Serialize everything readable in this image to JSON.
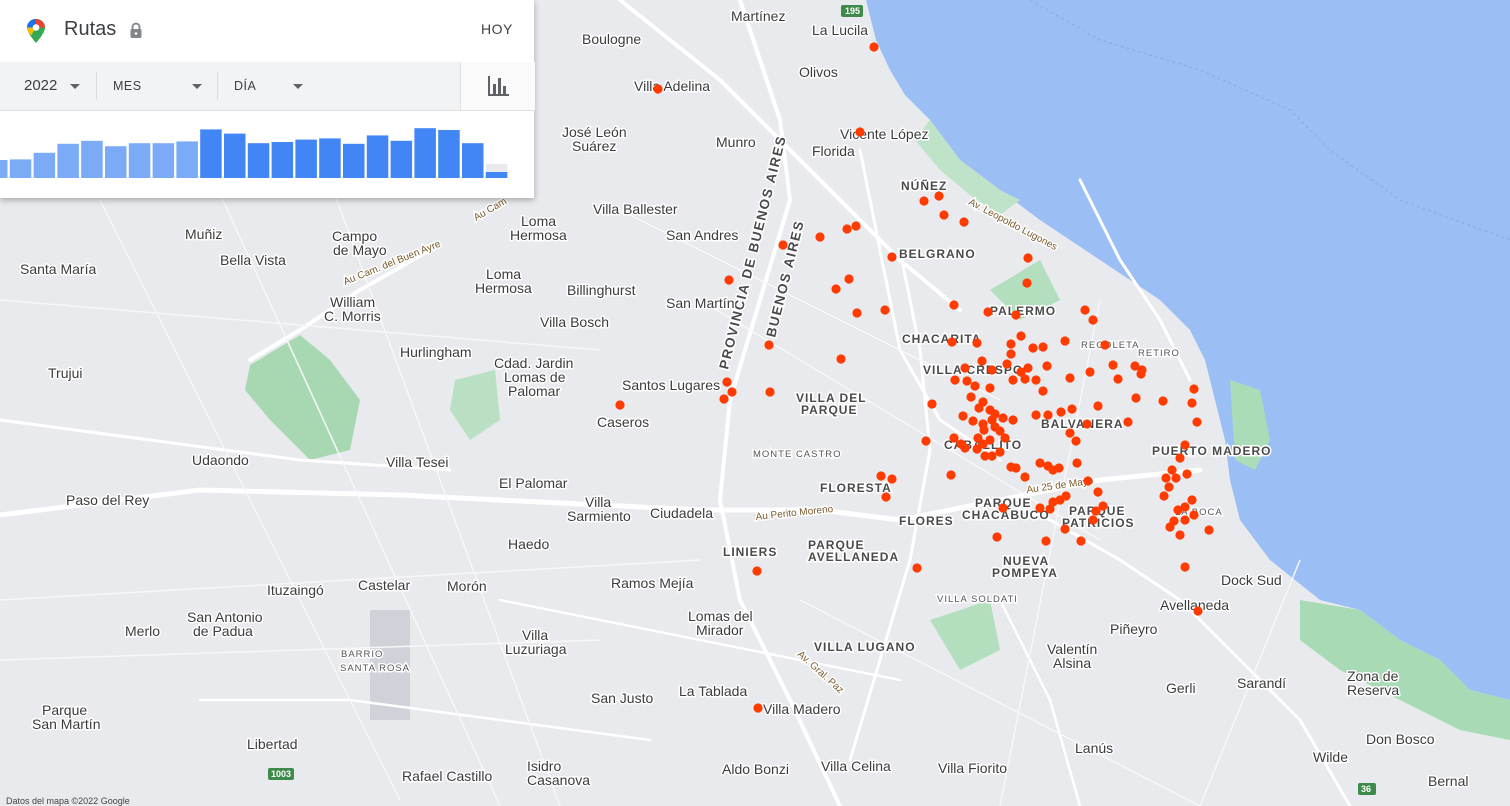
{
  "panel": {
    "title": "Rutas",
    "today_label": "HOY",
    "filters": {
      "year": "2022",
      "month": "MES",
      "day": "DÍA"
    },
    "histogram": {
      "values": [
        0.3,
        0.31,
        0.42,
        0.57,
        0.62,
        0.53,
        0.58,
        0.58,
        0.61,
        0.81,
        0.74,
        0.58,
        0.6,
        0.64,
        0.66,
        0.57,
        0.71,
        0.62,
        0.83,
        0.8,
        0.58,
        0.1
      ],
      "highlight_from_index": 9,
      "light_color": "#7babf6",
      "dark_color": "#4285f4"
    }
  },
  "map": {
    "places": [
      {
        "t": "Martínez"
      },
      {
        "t": "La Lucila"
      },
      {
        "t": "Boulogne"
      },
      {
        "t": "Olivos"
      },
      {
        "t": "Villa Adelina"
      },
      {
        "t": "Vicente López"
      },
      {
        "t": "Florida"
      },
      {
        "t": "José León"
      },
      {
        "t": "Suárez"
      },
      {
        "t": "Munro"
      },
      {
        "t": "Villa Ballester"
      },
      {
        "t": "Muñiz"
      },
      {
        "t": "Campo"
      },
      {
        "t": "de Mayo"
      },
      {
        "t": "Loma"
      },
      {
        "t": "Hermosa"
      },
      {
        "t": "San Andres"
      },
      {
        "t": "Santa María"
      },
      {
        "t": "Bella Vista"
      },
      {
        "t": "Loma"
      },
      {
        "t": "Hermosa"
      },
      {
        "t": "Billinghurst"
      },
      {
        "t": "San Martín"
      },
      {
        "t": "William"
      },
      {
        "t": "C. Morris"
      },
      {
        "t": "Villa Bosch"
      },
      {
        "t": "Hurlingham"
      },
      {
        "t": "Cdad. Jardin"
      },
      {
        "t": "Lomas de"
      },
      {
        "t": "Palomar"
      },
      {
        "t": "Trujui"
      },
      {
        "t": "Santos Lugares"
      },
      {
        "t": "Caseros"
      },
      {
        "t": "Udaondo"
      },
      {
        "t": "Villa Tesei"
      },
      {
        "t": "El Palomar"
      },
      {
        "t": "Paso del Rey"
      },
      {
        "t": "Villa"
      },
      {
        "t": "Sarmiento"
      },
      {
        "t": "Ciudadela"
      },
      {
        "t": "Haedo"
      },
      {
        "t": "Ramos Mejía"
      },
      {
        "t": "Ituzaingó"
      },
      {
        "t": "Castelar"
      },
      {
        "t": "Morón"
      },
      {
        "t": "Merlo"
      },
      {
        "t": "San Antonio"
      },
      {
        "t": "de Padua"
      },
      {
        "t": "Lomas del"
      },
      {
        "t": "Mirador"
      },
      {
        "t": "Villa"
      },
      {
        "t": "Luzuriaga"
      },
      {
        "t": "Parque"
      },
      {
        "t": "San Martín"
      },
      {
        "t": "San Justo"
      },
      {
        "t": "La Tablada"
      },
      {
        "t": "Villa Madero"
      },
      {
        "t": "Libertad"
      },
      {
        "t": "Rafael Castillo"
      },
      {
        "t": "Isidro"
      },
      {
        "t": "Casanova"
      },
      {
        "t": "Aldo Bonzi"
      },
      {
        "t": "Villa Celina"
      },
      {
        "t": "Villa Fiorito"
      },
      {
        "t": "Lanús"
      },
      {
        "t": "Valentín"
      },
      {
        "t": "Alsina"
      },
      {
        "t": "Piñeyro"
      },
      {
        "t": "Avellaneda"
      },
      {
        "t": "Dock Sud"
      },
      {
        "t": "Gerli"
      },
      {
        "t": "Sarandí"
      },
      {
        "t": "Zona de"
      },
      {
        "t": "Reserva"
      },
      {
        "t": "Don Bosco"
      },
      {
        "t": "Wilde"
      },
      {
        "t": "Bernal"
      }
    ],
    "neighborhoods": [
      {
        "t": "NÚÑEZ"
      },
      {
        "t": "BELGRANO"
      },
      {
        "t": "PALERMO"
      },
      {
        "t": "CHACARITA"
      },
      {
        "t": "VILLA CRESPO"
      },
      {
        "t": "VILLA DEL"
      },
      {
        "t": "PARQUE"
      },
      {
        "t": "BALVANERA"
      },
      {
        "t": "CABALLITO"
      },
      {
        "t": "PUERTO MADERO"
      },
      {
        "t": "FLORESTA"
      },
      {
        "t": "PARQUE"
      },
      {
        "t": "CHACABUCO"
      },
      {
        "t": "PARQUE"
      },
      {
        "t": "PATRICIOS"
      },
      {
        "t": "FLORES"
      },
      {
        "t": "LINIERS"
      },
      {
        "t": "PARQUE"
      },
      {
        "t": "AVELLANEDA"
      },
      {
        "t": "NUEVA"
      },
      {
        "t": "POMPEYA"
      },
      {
        "t": "VILLA LUGANO"
      }
    ],
    "small_neighborhoods": [
      {
        "t": "RECOLETA"
      },
      {
        "t": "RETIRO"
      },
      {
        "t": "MONTE CASTRO"
      },
      {
        "t": "VILLA SOLDATI"
      },
      {
        "t": "LA BOCA"
      },
      {
        "t": "BARRIO"
      },
      {
        "t": "SANTA ROSA"
      }
    ],
    "road_labels": [
      "Au Cam. del Buen Ayre",
      "Av. Leopoldo Lugones",
      "Au 25 de Mayo",
      "Au Perito Moreno",
      "Av. Gral. Paz",
      "Au Cam"
    ],
    "province_label_1": "PROVINCIA DE BUENOS AIRES",
    "province_label_2": "BUENOS AIRES",
    "shields": [
      "195",
      "1003",
      "36"
    ],
    "copyright": "Datos del mapa ©2022 Google",
    "dot_color": "#ff3b00",
    "water_color": "#9bbff4"
  }
}
